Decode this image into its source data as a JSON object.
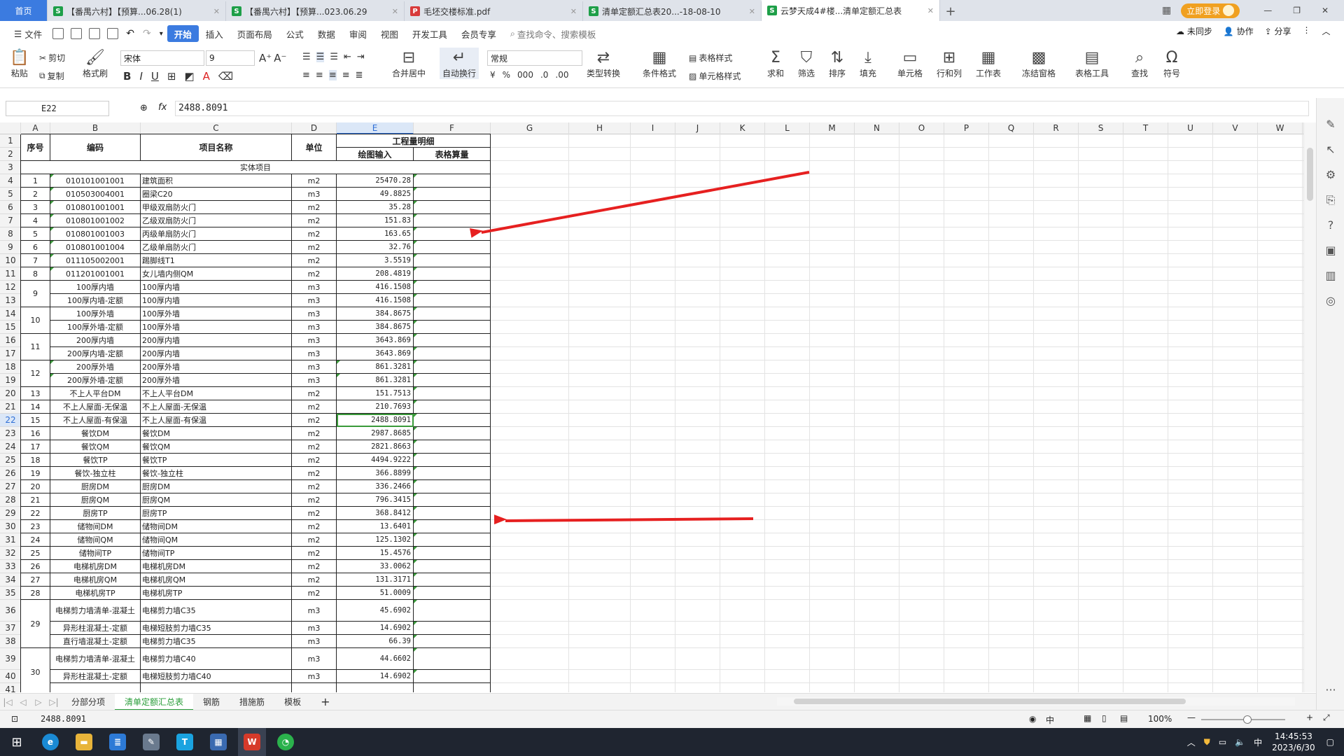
{
  "tabs": {
    "home": "首页",
    "items": [
      {
        "label": "【番禺六村】【预算...06.28(1)",
        "icon": "S",
        "color": "#1e9f48"
      },
      {
        "label": "【番禺六村】【预算...023.06.29",
        "icon": "S",
        "color": "#1e9f48"
      },
      {
        "label": "毛坯交楼标准.pdf",
        "icon": "P",
        "color": "#d83b3b"
      },
      {
        "label": "清单定额汇总表20...-18-08-10",
        "icon": "S",
        "color": "#1e9f48"
      },
      {
        "label": "云梦天成4#楼...清单定额汇总表",
        "icon": "S",
        "color": "#1e9f48"
      }
    ],
    "login": "立即登录"
  },
  "menu": {
    "file": "文件",
    "items": [
      "开始",
      "插入",
      "页面布局",
      "公式",
      "数据",
      "审阅",
      "视图",
      "开发工具",
      "会员专享"
    ],
    "active": "开始",
    "search": "查找命令、搜索模板",
    "sync": "未同步",
    "collab": "协作",
    "share": "分享"
  },
  "ribbon": {
    "paste": "粘贴",
    "cut": "剪切",
    "copy": "复制",
    "format_painter": "格式刷",
    "font": "宋体",
    "size": "9",
    "merge": "合并居中",
    "wrap": "自动换行",
    "number_format": "常规",
    "type_convert": "类型转换",
    "cond_format": "条件格式",
    "table_style": "表格样式",
    "cell_style": "单元格样式",
    "sum": "求和",
    "filter": "筛选",
    "sort": "排序",
    "fill": "填充",
    "cell": "单元格",
    "rowcol": "行和列",
    "worksheet": "工作表",
    "freeze": "冻结窗格",
    "tools": "表格工具",
    "find": "查找",
    "symbol": "符号"
  },
  "formula_bar": {
    "cell_ref": "E22",
    "fx": "fx",
    "value": "2488.8091"
  },
  "columns": [
    "A",
    "B",
    "C",
    "D",
    "E",
    "F",
    "G",
    "H",
    "I",
    "J",
    "K",
    "L",
    "M",
    "N",
    "O",
    "P",
    "Q",
    "R",
    "S",
    "T",
    "U",
    "V",
    "W"
  ],
  "selected_column": "E",
  "selected_row": "22",
  "header": {
    "seq": "序号",
    "code": "编码",
    "name": "项目名称",
    "unit": "单位",
    "detail": "工程量明细",
    "draw": "绘图输入",
    "table": "表格算量",
    "section": "实体项目"
  },
  "rows": [
    {
      "r": "4",
      "seq": "1",
      "code": "010101001001",
      "name": "建筑面积",
      "unit": "m2",
      "val": "25470.28"
    },
    {
      "r": "5",
      "seq": "2",
      "code": "010503004001",
      "name": "圈梁C20",
      "unit": "m3",
      "val": "49.8825"
    },
    {
      "r": "6",
      "seq": "3",
      "code": "010801001001",
      "name": "甲级双扇防火门",
      "unit": "m2",
      "val": "35.28"
    },
    {
      "r": "7",
      "seq": "4",
      "code": "010801001002",
      "name": "乙级双扇防火门",
      "unit": "m2",
      "val": "151.83"
    },
    {
      "r": "8",
      "seq": "5",
      "code": "010801001003",
      "name": "丙级单扇防火门",
      "unit": "m2",
      "val": "163.65"
    },
    {
      "r": "9",
      "seq": "6",
      "code": "010801001004",
      "name": "乙级单扇防火门",
      "unit": "m2",
      "val": "32.76"
    },
    {
      "r": "10",
      "seq": "7",
      "code": "011105002001",
      "name": "踢脚线T1",
      "unit": "m2",
      "val": "3.5519"
    },
    {
      "r": "11",
      "seq": "8",
      "code": "011201001001",
      "name": "女儿墙内侧QM",
      "unit": "m2",
      "val": "208.4819"
    },
    {
      "r": "12",
      "seq": "9",
      "code": "100厚内墙",
      "name": "100厚内墙",
      "unit": "m3",
      "val": "416.1508"
    },
    {
      "r": "13",
      "seq": "",
      "code": "100厚内墙-定额",
      "name": "100厚内墙",
      "unit": "m3",
      "val": "416.1508"
    },
    {
      "r": "14",
      "seq": "10",
      "code": "100厚外墙",
      "name": "100厚外墙",
      "unit": "m3",
      "val": "384.8675"
    },
    {
      "r": "15",
      "seq": "",
      "code": "100厚外墙-定额",
      "name": "100厚外墙",
      "unit": "m3",
      "val": "384.8675"
    },
    {
      "r": "16",
      "seq": "11",
      "code": "200厚内墙",
      "name": "200厚内墙",
      "unit": "m3",
      "val": "3643.869"
    },
    {
      "r": "17",
      "seq": "",
      "code": "200厚内墙-定额",
      "name": "200厚内墙",
      "unit": "m3",
      "val": "3643.869"
    },
    {
      "r": "18",
      "seq": "12",
      "code": "200厚外墙",
      "name": "200厚外墙",
      "unit": "m3",
      "val": "861.3281"
    },
    {
      "r": "19",
      "seq": "",
      "code": "200厚外墙-定额",
      "name": "200厚外墙",
      "unit": "m3",
      "val": "861.3281"
    },
    {
      "r": "20",
      "seq": "13",
      "code": "不上人平台DM",
      "name": "不上人平台DM",
      "unit": "m2",
      "val": "151.7513"
    },
    {
      "r": "21",
      "seq": "14",
      "code": "不上人屋面-无保温",
      "name": "不上人屋面-无保温",
      "unit": "m2",
      "val": "210.7693"
    },
    {
      "r": "22",
      "seq": "15",
      "code": "不上人屋面-有保温",
      "name": "不上人屋面-有保温",
      "unit": "m2",
      "val": "2488.8091"
    },
    {
      "r": "23",
      "seq": "16",
      "code": "餐饮DM",
      "name": "餐饮DM",
      "unit": "m2",
      "val": "2987.8685"
    },
    {
      "r": "24",
      "seq": "17",
      "code": "餐饮QM",
      "name": "餐饮QM",
      "unit": "m2",
      "val": "2821.8663"
    },
    {
      "r": "25",
      "seq": "18",
      "code": "餐饮TP",
      "name": "餐饮TP",
      "unit": "m2",
      "val": "4494.9222"
    },
    {
      "r": "26",
      "seq": "19",
      "code": "餐饮-独立柱",
      "name": "餐饮-独立柱",
      "unit": "m2",
      "val": "366.8899"
    },
    {
      "r": "27",
      "seq": "20",
      "code": "厨房DM",
      "name": "厨房DM",
      "unit": "m2",
      "val": "336.2466"
    },
    {
      "r": "28",
      "seq": "21",
      "code": "厨房QM",
      "name": "厨房QM",
      "unit": "m2",
      "val": "796.3415"
    },
    {
      "r": "29",
      "seq": "22",
      "code": "厨房TP",
      "name": "厨房TP",
      "unit": "m2",
      "val": "368.8412"
    },
    {
      "r": "30",
      "seq": "23",
      "code": "储物间DM",
      "name": "储物间DM",
      "unit": "m2",
      "val": "13.6401"
    },
    {
      "r": "31",
      "seq": "24",
      "code": "储物间QM",
      "name": "储物间QM",
      "unit": "m2",
      "val": "125.1302"
    },
    {
      "r": "32",
      "seq": "25",
      "code": "储物间TP",
      "name": "储物间TP",
      "unit": "m2",
      "val": "15.4576"
    },
    {
      "r": "33",
      "seq": "26",
      "code": "电梯机房DM",
      "name": "电梯机房DM",
      "unit": "m2",
      "val": "33.0062"
    },
    {
      "r": "34",
      "seq": "27",
      "code": "电梯机房QM",
      "name": "电梯机房QM",
      "unit": "m2",
      "val": "131.3171"
    },
    {
      "r": "35",
      "seq": "28",
      "code": "电梯机房TP",
      "name": "电梯机房TP",
      "unit": "m2",
      "val": "51.0009"
    },
    {
      "r": "36",
      "seq": "29",
      "code": "电梯剪力墙清单-混凝土",
      "name": "电梯剪力墙C35",
      "unit": "m3",
      "val": "45.6902"
    },
    {
      "r": "37",
      "seq": "",
      "code": "异形柱混凝土-定额",
      "name": "电梯短肢剪力墙C35",
      "unit": "m3",
      "val": "14.6902"
    },
    {
      "r": "38",
      "seq": "",
      "code": "直行墙混凝土-定额",
      "name": "电梯剪力墙C35",
      "unit": "m3",
      "val": "66.39"
    },
    {
      "r": "39",
      "seq": "30",
      "code": "电梯剪力墙清单-混凝土",
      "name": "电梯剪力墙C40",
      "unit": "m3",
      "val": "44.6602"
    },
    {
      "r": "40",
      "seq": "",
      "code": "异形柱混凝土-定额",
      "name": "电梯短肢剪力墙C40",
      "unit": "m3",
      "val": "14.6902"
    }
  ],
  "sheets": [
    "分部分项",
    "清单定额汇总表",
    "钢筋",
    "措施筋",
    "模板"
  ],
  "active_sheet": "清单定额汇总表",
  "status": {
    "value": "2488.8091",
    "zoom": "100%"
  },
  "taskbar": {
    "ime": "中",
    "time": "14:45:53",
    "date": "2023/6/30"
  },
  "colors": {
    "accent": "#3b7be0",
    "sheet_green": "#2a9d3a",
    "arrow": "#e62020"
  }
}
